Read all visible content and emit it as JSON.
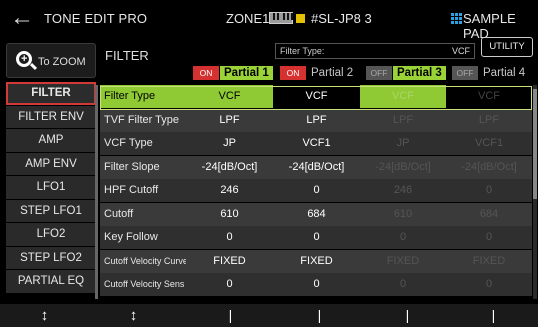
{
  "topbar": {
    "back_icon": "left-arrow-icon",
    "app_title": "TONE EDIT PRO",
    "zone": "ZONE1",
    "tone_name": "#SL-JP8 3",
    "pad_label": "SAMPLE PAD"
  },
  "zoom_button": {
    "label": "To ZOOM",
    "icon": "zoom-in-icon"
  },
  "sidebar": {
    "items": [
      {
        "label": "FILTER",
        "active": true
      },
      {
        "label": "FILTER ENV"
      },
      {
        "label": "AMP"
      },
      {
        "label": "AMP ENV"
      },
      {
        "label": "LFO1"
      },
      {
        "label": "STEP LFO1"
      },
      {
        "label": "LFO2"
      },
      {
        "label": "STEP LFO2"
      },
      {
        "label": "PARTIAL EQ"
      }
    ]
  },
  "header": {
    "title": "FILTER",
    "filter_type_key": "Filter Type:",
    "filter_type_value": "VCF",
    "utility_label": "UTILITY"
  },
  "partials": [
    {
      "switch": "ON",
      "name": "Partial 1",
      "highlight": true
    },
    {
      "switch": "ON",
      "name": "Partial 2",
      "highlight": false
    },
    {
      "switch": "OFF",
      "name": "Partial 3",
      "highlight": true
    },
    {
      "switch": "OFF",
      "name": "Partial 4",
      "highlight": false
    }
  ],
  "params": [
    {
      "name": "Filter Type",
      "values": [
        "VCF",
        "VCF",
        "VCF",
        "VCF"
      ]
    },
    {
      "name": "TVF Filter Type",
      "values": [
        "LPF",
        "LPF",
        "LPF",
        "LPF"
      ]
    },
    {
      "name": "VCF Type",
      "values": [
        "JP",
        "VCF1",
        "JP",
        "VCF1"
      ]
    },
    {
      "name": "Filter Slope",
      "values": [
        "-24[dB/Oct]",
        "-24[dB/Oct]",
        "-24[dB/Oct]",
        "-24[dB/Oct]"
      ]
    },
    {
      "name": "HPF Cutoff",
      "values": [
        "246",
        "0",
        "246",
        "0"
      ]
    },
    {
      "name": "Cutoff",
      "values": [
        "610",
        "684",
        "610",
        "684"
      ]
    },
    {
      "name": "Key Follow",
      "values": [
        "0",
        "0",
        "0",
        "0"
      ]
    },
    {
      "name": "Cutoff Velocity Curve",
      "values": [
        "FIXED",
        "FIXED",
        "FIXED",
        "FIXED"
      ]
    },
    {
      "name": "Cutoff Velocity Sens",
      "values": [
        "0",
        "0",
        "0",
        "0"
      ]
    }
  ],
  "knobs": [
    "↕",
    "↕",
    "|",
    "|",
    "|",
    "|"
  ]
}
